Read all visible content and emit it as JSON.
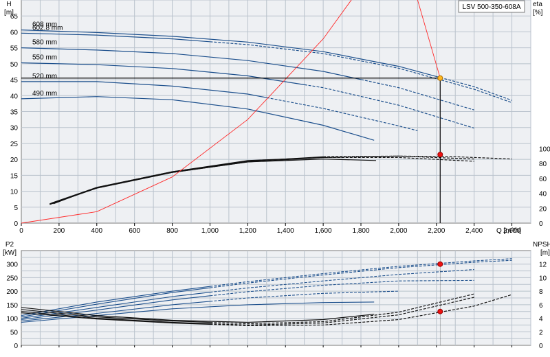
{
  "chart_data": [
    {
      "type": "line",
      "title": "LSV 500-350-608A",
      "xlabel": "Q [m³/h]",
      "ylabel_left": "H [m]",
      "ylabel_right": "eta [%]",
      "xlim": [
        0,
        2700
      ],
      "ylim_left": [
        0,
        70
      ],
      "ylim_right": [
        0,
        100
      ],
      "x_ticks": [
        "0",
        "200",
        "400",
        "600",
        "800",
        "1,000",
        "1,200",
        "1,400",
        "1,600",
        "1,800",
        "2,000",
        "2,200",
        "2,400",
        "2,600"
      ],
      "y_left_ticks": [
        "0",
        "5",
        "10",
        "15",
        "20",
        "25",
        "30",
        "35",
        "40",
        "45",
        "50",
        "55",
        "60",
        "65"
      ],
      "y_right_ticks": [
        "0",
        "20",
        "40",
        "60",
        "80",
        "100"
      ],
      "grid": true,
      "head_curves": [
        {
          "name": "608 mm",
          "x": [
            0,
            400,
            800,
            1200,
            1600,
            2000,
            2400,
            2600
          ],
          "y": [
            60.6,
            59.8,
            58.6,
            56.8,
            53.8,
            49.2,
            42.8,
            38.5
          ],
          "dashed_from": 2200
        },
        {
          "name": "602.8 mm",
          "x": [
            0,
            400,
            800,
            1200,
            1600,
            2000,
            2400,
            2600
          ],
          "y": [
            59.6,
            59.0,
            57.8,
            56.0,
            53.2,
            48.6,
            42.0,
            37.8
          ],
          "dashed_from": 1000
        },
        {
          "name": "580 mm",
          "x": [
            0,
            400,
            800,
            1200,
            1600,
            2000,
            2400
          ],
          "y": [
            55.0,
            54.3,
            53.2,
            51.0,
            47.6,
            42.5,
            35.5
          ],
          "dashed_from": 1800
        },
        {
          "name": "550 mm",
          "x": [
            0,
            400,
            800,
            1200,
            1600,
            2000,
            2400
          ],
          "y": [
            50.3,
            49.7,
            48.5,
            46.2,
            42.5,
            37.0,
            29.8
          ],
          "dashed_from": 1500
        },
        {
          "name": "520 mm",
          "x": [
            0,
            400,
            800,
            1200,
            1600,
            2000,
            2100
          ],
          "y": [
            44.4,
            44.4,
            43.0,
            40.5,
            36.0,
            30.5,
            29.0
          ],
          "dashed_from": 1300
        },
        {
          "name": "490 mm",
          "x": [
            0,
            400,
            800,
            1200,
            1600,
            1870
          ],
          "y": [
            39.0,
            39.7,
            38.7,
            35.8,
            30.7,
            26.0
          ]
        }
      ],
      "eta_curves": [
        {
          "name": "608 mm",
          "x": [
            150,
            400,
            800,
            1200,
            1600,
            2000,
            2300,
            2600
          ],
          "y": [
            26,
            47,
            68,
            82,
            88,
            90,
            89,
            86
          ],
          "dashed_from": 1700
        },
        {
          "name": "580 mm",
          "x": [
            160,
            400,
            800,
            1200,
            1600,
            2000,
            2400
          ],
          "y": [
            27,
            48,
            69,
            83,
            89,
            90,
            86
          ],
          "dashed_from": 1600
        },
        {
          "name": "550 mm",
          "x": [
            170,
            400,
            800,
            1200,
            1600,
            2000,
            2400
          ],
          "y": [
            26,
            48,
            69,
            84,
            88,
            88,
            83
          ],
          "dashed_from": 1500
        },
        {
          "name": "490 mm",
          "x": [
            150,
            400,
            800,
            1200,
            1600,
            1880
          ],
          "y": [
            25,
            47,
            68,
            82,
            86,
            84
          ]
        }
      ],
      "system_curve": {
        "x": [
          0,
          400,
          800,
          1200,
          1600,
          2000,
          2220
        ],
        "y": [
          0,
          3.6,
          14.5,
          32.5,
          57.8,
          90.5,
          45.5
        ]
      },
      "duty_point": {
        "q": 2220,
        "h": 45.5,
        "eta": 92
      }
    },
    {
      "type": "line",
      "ylabel_left": "P2 [kW]",
      "ylabel_right": "NPSH [m]",
      "xlim": [
        0,
        2700
      ],
      "ylim_left": [
        0,
        350
      ],
      "ylim_right": [
        0,
        14
      ],
      "y_left_ticks": [
        "0",
        "50",
        "100",
        "150",
        "200",
        "250",
        "300"
      ],
      "y_right_ticks": [
        "0",
        "2",
        "4",
        "6",
        "8",
        "10",
        "12"
      ],
      "grid": true,
      "power_curves": [
        {
          "name": "608 mm",
          "x": [
            0,
            400,
            800,
            1200,
            1600,
            2000,
            2400,
            2600
          ],
          "y": [
            110,
            160,
            200,
            235,
            265,
            292,
            312,
            320
          ],
          "dashed_from": 1000
        },
        {
          "name": "602.8 mm",
          "x": [
            0,
            400,
            800,
            1200,
            1600,
            2000,
            2400,
            2600
          ],
          "y": [
            105,
            152,
            195,
            230,
            260,
            287,
            307,
            314
          ],
          "dashed_from": 1000
        },
        {
          "name": "580 mm",
          "x": [
            0,
            400,
            800,
            1200,
            1600,
            2000,
            2400
          ],
          "y": [
            100,
            140,
            180,
            212,
            238,
            262,
            280
          ],
          "dashed_from": 1000
        },
        {
          "name": "550 mm",
          "x": [
            0,
            400,
            800,
            1200,
            1600,
            2000,
            2400
          ],
          "y": [
            95,
            130,
            168,
            198,
            222,
            238,
            240
          ],
          "dashed_from": 1000
        },
        {
          "name": "520 mm",
          "x": [
            0,
            400,
            800,
            1200,
            1600,
            2000
          ],
          "y": [
            90,
            118,
            150,
            175,
            192,
            200
          ],
          "dashed_from": 1000
        },
        {
          "name": "490 mm",
          "x": [
            0,
            400,
            800,
            1200,
            1600,
            1870
          ],
          "y": [
            85,
            110,
            135,
            150,
            158,
            160
          ]
        }
      ],
      "npsh_curves": [
        {
          "name": "608 mm",
          "x": [
            0,
            400,
            800,
            1200,
            1600,
            2000,
            2400,
            2600
          ],
          "y": [
            4.8,
            3.9,
            3.3,
            2.9,
            3.0,
            3.8,
            5.8,
            7.5
          ],
          "dashed_from": 1000
        },
        {
          "name": "580 mm",
          "x": [
            0,
            400,
            800,
            1200,
            1600,
            2000,
            2400
          ],
          "y": [
            5.0,
            4.0,
            3.4,
            3.0,
            3.3,
            4.5,
            7.1
          ],
          "dashed_from": 1000
        },
        {
          "name": "550 mm",
          "x": [
            0,
            400,
            800,
            1200,
            1600,
            2000,
            2400
          ],
          "y": [
            5.3,
            4.2,
            3.6,
            3.2,
            3.5,
            4.9,
            7.6
          ],
          "dashed_from": 1000
        },
        {
          "name": "490 mm",
          "x": [
            0,
            400,
            800,
            1200,
            1600,
            1870
          ],
          "y": [
            5.6,
            4.4,
            3.7,
            3.4,
            3.8,
            4.6
          ]
        }
      ],
      "duty_point": {
        "q": 2220,
        "p2": 300,
        "npsh": 5.0
      }
    }
  ]
}
